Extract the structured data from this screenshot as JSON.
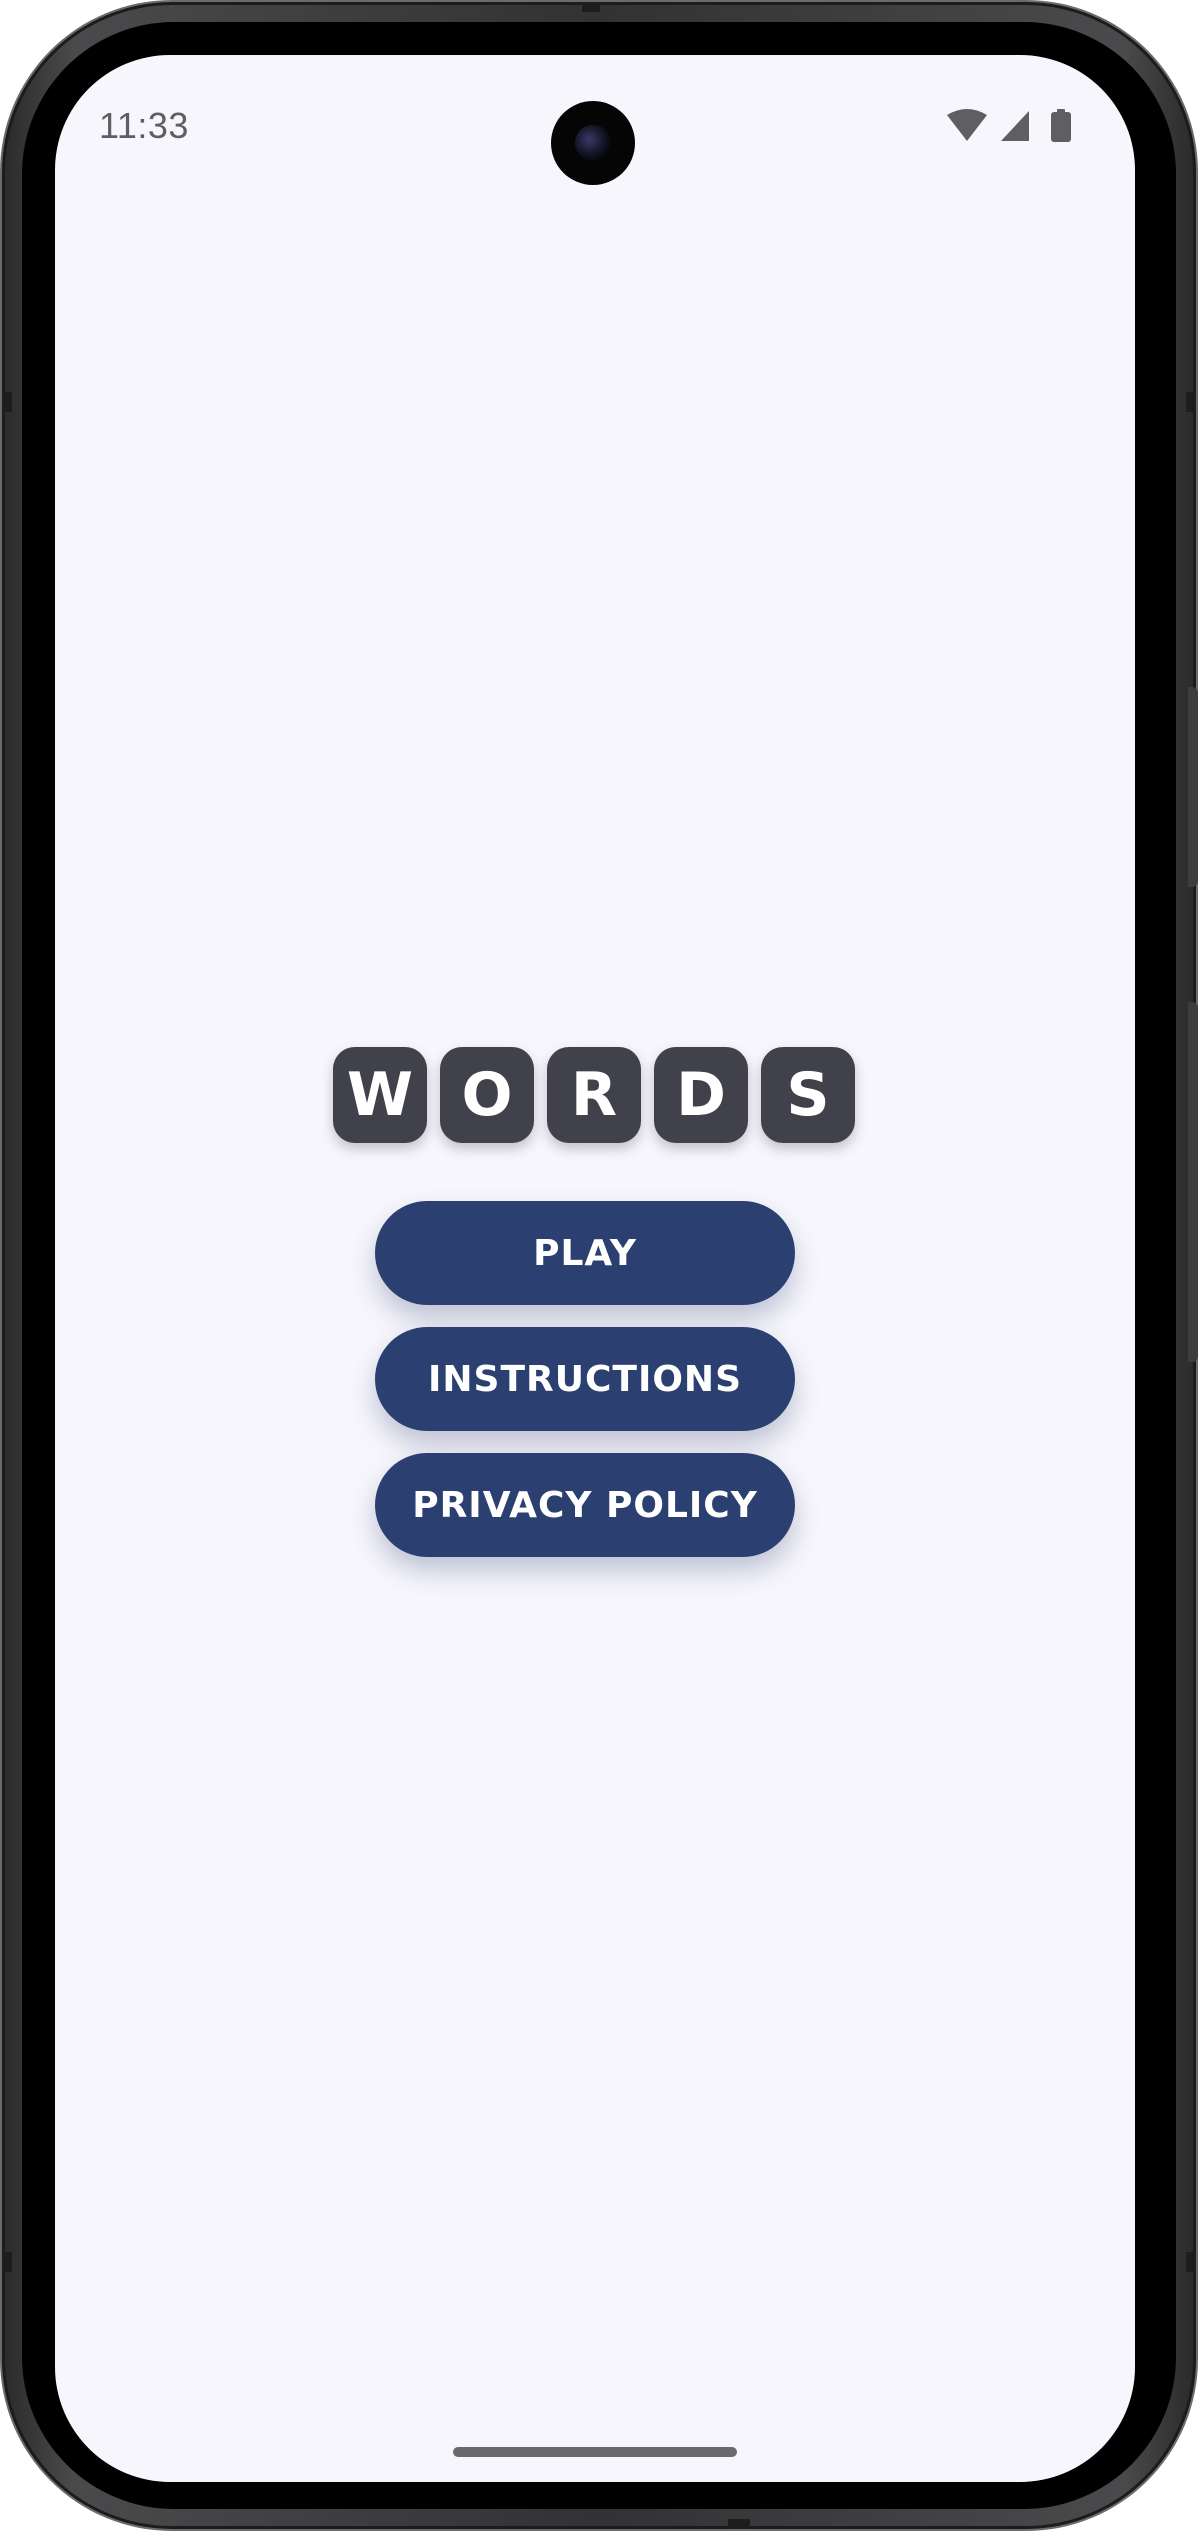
{
  "status_bar": {
    "time": "11:33"
  },
  "logo": {
    "letters": [
      "W",
      "O",
      "R",
      "D",
      "S"
    ]
  },
  "menu": {
    "play_label": "PLAY",
    "instructions_label": "INSTRUCTIONS",
    "privacy_policy_label": "PRIVACY POLICY"
  },
  "icons": {
    "status": [
      "wifi-icon",
      "cell-signal-icon",
      "battery-icon"
    ],
    "camera": "front-camera-icon"
  },
  "colors": {
    "background": "#f7f6fc",
    "tile": "#40414a",
    "button": "#2b4071",
    "button_text": "#ffffff"
  }
}
